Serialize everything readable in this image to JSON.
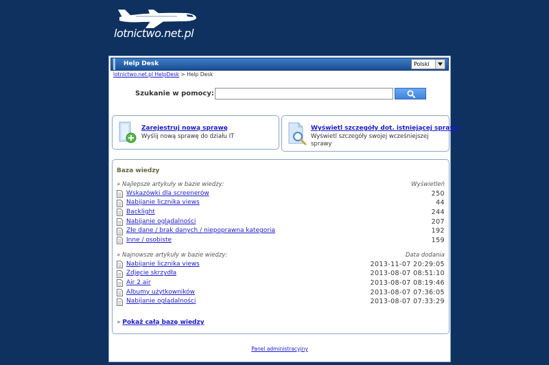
{
  "logo": {
    "text": "lotnictwo.net.pl"
  },
  "header": {
    "title": "Help Desk",
    "language": "Polski"
  },
  "breadcrumb": {
    "home": "lotnictwo.net.pl HelpDesk",
    "separator": " > ",
    "current": "Help Desk"
  },
  "search": {
    "label": "Szukanie w pomocy:",
    "value": "",
    "placeholder": ""
  },
  "actions": {
    "new_ticket": {
      "title": "Zarejestruj nową sprawę",
      "description": "Wyślij nową sprawę do działu IT"
    },
    "view_ticket": {
      "title": "Wyświetl szczegóły dot. istniejącej sprawy",
      "description": "Wyświetl szczegóły swojej wcześniejszej sprawy"
    }
  },
  "knowledge_base": {
    "title": "Baza wiedzy",
    "top": {
      "heading": "» Najlepsze artykuły w bazie wiedzy:",
      "column": "Wyświetleń",
      "items": [
        {
          "title": "Wskazówki dla screenerów",
          "value": "250"
        },
        {
          "title": "Nabijanie licznika views",
          "value": "44"
        },
        {
          "title": "Backlight",
          "value": "244"
        },
        {
          "title": "Nabijanie oglądalności",
          "value": "207"
        },
        {
          "title": "Złe dane / brak danych / niepoprawna kategoria",
          "value": "192"
        },
        {
          "title": "Inne / osobiste",
          "value": "159"
        }
      ]
    },
    "newest": {
      "heading": "» Najnowsze artykuły w bazie wiedzy:",
      "column": "Data dodania",
      "items": [
        {
          "title": "Nabijanie licznika views",
          "value": "2013-11-07 20:29:05"
        },
        {
          "title": "Zdjęcie skrzydła",
          "value": "2013-08-07 08:51:10"
        },
        {
          "title": "Air 2 air",
          "value": "2013-08-07 08:19:46"
        },
        {
          "title": "Albumy użytkowników",
          "value": "2013-08-07 07:36:05"
        },
        {
          "title": "Nabijanie oglądalności",
          "value": "2013-08-07 07:33:29"
        }
      ]
    },
    "show_all_prefix": "»",
    "show_all": "Pokaż całą bazę wiedzy"
  },
  "footer": {
    "admin_link": "Panel administracyjny"
  },
  "colors": {
    "background": "#0e3160",
    "header_blue": "#1b4f95",
    "link": "#1a1acc",
    "border": "#8aa4c6"
  },
  "icons": {
    "logo": "airplane-icon",
    "search": "magnifier-icon",
    "new_ticket": "new-document-icon",
    "view_ticket": "search-document-icon",
    "article": "document-icon",
    "language": "dropdown-arrow-icon"
  }
}
